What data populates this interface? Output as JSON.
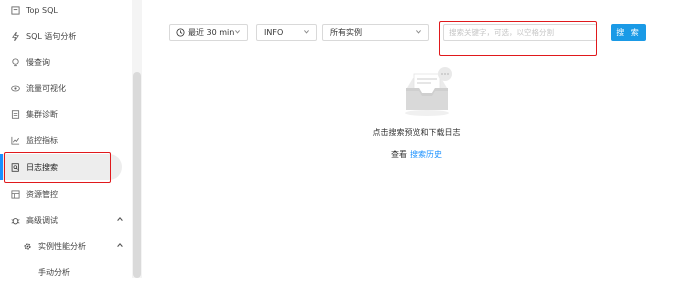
{
  "sidebar": {
    "items": [
      {
        "label": "Top SQL",
        "icon": "top-sql-icon"
      },
      {
        "label": "SQL 语句分析",
        "icon": "lightning-icon"
      },
      {
        "label": "慢查询",
        "icon": "bulb-icon"
      },
      {
        "label": "流量可视化",
        "icon": "eye-icon"
      },
      {
        "label": "集群诊断",
        "icon": "report-icon"
      },
      {
        "label": "监控指标",
        "icon": "line-chart-icon"
      },
      {
        "label": "日志搜索",
        "icon": "file-search-icon"
      },
      {
        "label": "资源管控",
        "icon": "resource-icon"
      },
      {
        "label": "高级调试",
        "icon": "bug-icon"
      },
      {
        "label": "实例性能分析",
        "icon": "gear-icon"
      },
      {
        "label": "手动分析"
      }
    ],
    "active": "日志搜索"
  },
  "toolbar": {
    "time_range": "最近 30 min",
    "log_level": "INFO",
    "instance": "所有实例",
    "search_placeholder": "搜索关键字，可选，以空格分割",
    "search_button": "搜 索"
  },
  "empty": {
    "title": "点击搜索预览和下载日志",
    "history_prefix": "查看",
    "history_link": "搜索历史"
  },
  "colors": {
    "accent": "#1890ff",
    "button": "#1a9ae6",
    "highlight_box": "#e0191c"
  }
}
